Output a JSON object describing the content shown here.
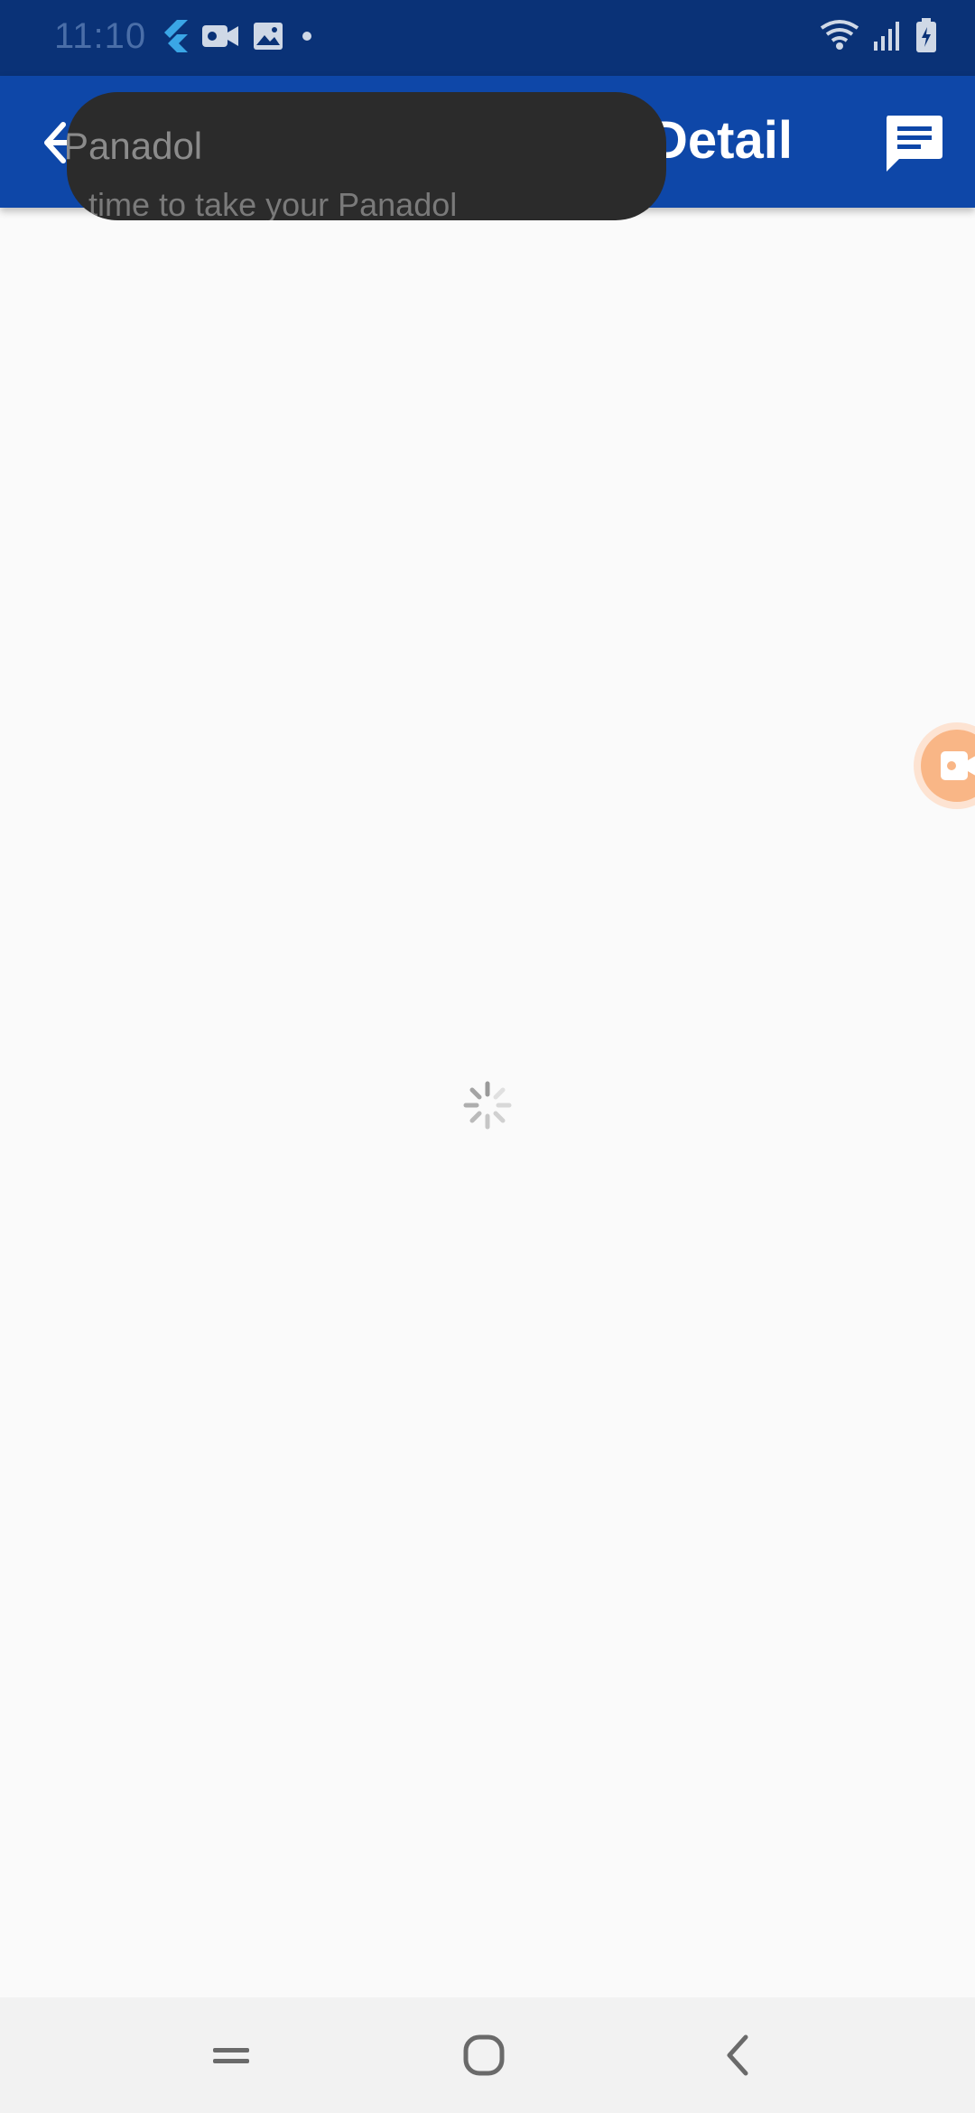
{
  "status_bar": {
    "time": "11:10",
    "left_icons": [
      "flutter-icon",
      "video-camera-icon",
      "image-icon",
      "dot-icon"
    ],
    "right_icons": [
      "wifi-icon",
      "signal-icon",
      "battery-charging-icon"
    ]
  },
  "app_bar": {
    "title": "Detail",
    "background_color": "#0e47a8",
    "back_icon": "arrow-back-icon",
    "action_icon": "chat-icon"
  },
  "toast": {
    "title": "Panadol",
    "body": "s time to take your Panadol"
  },
  "floating_button": {
    "icon": "video-camera-icon",
    "color": "#f9b686"
  },
  "content": {
    "state": "loading",
    "spinner_icon": "loading-spinner-icon"
  },
  "nav_bar": {
    "buttons": [
      "recent-apps-icon",
      "home-icon",
      "back-icon"
    ]
  }
}
